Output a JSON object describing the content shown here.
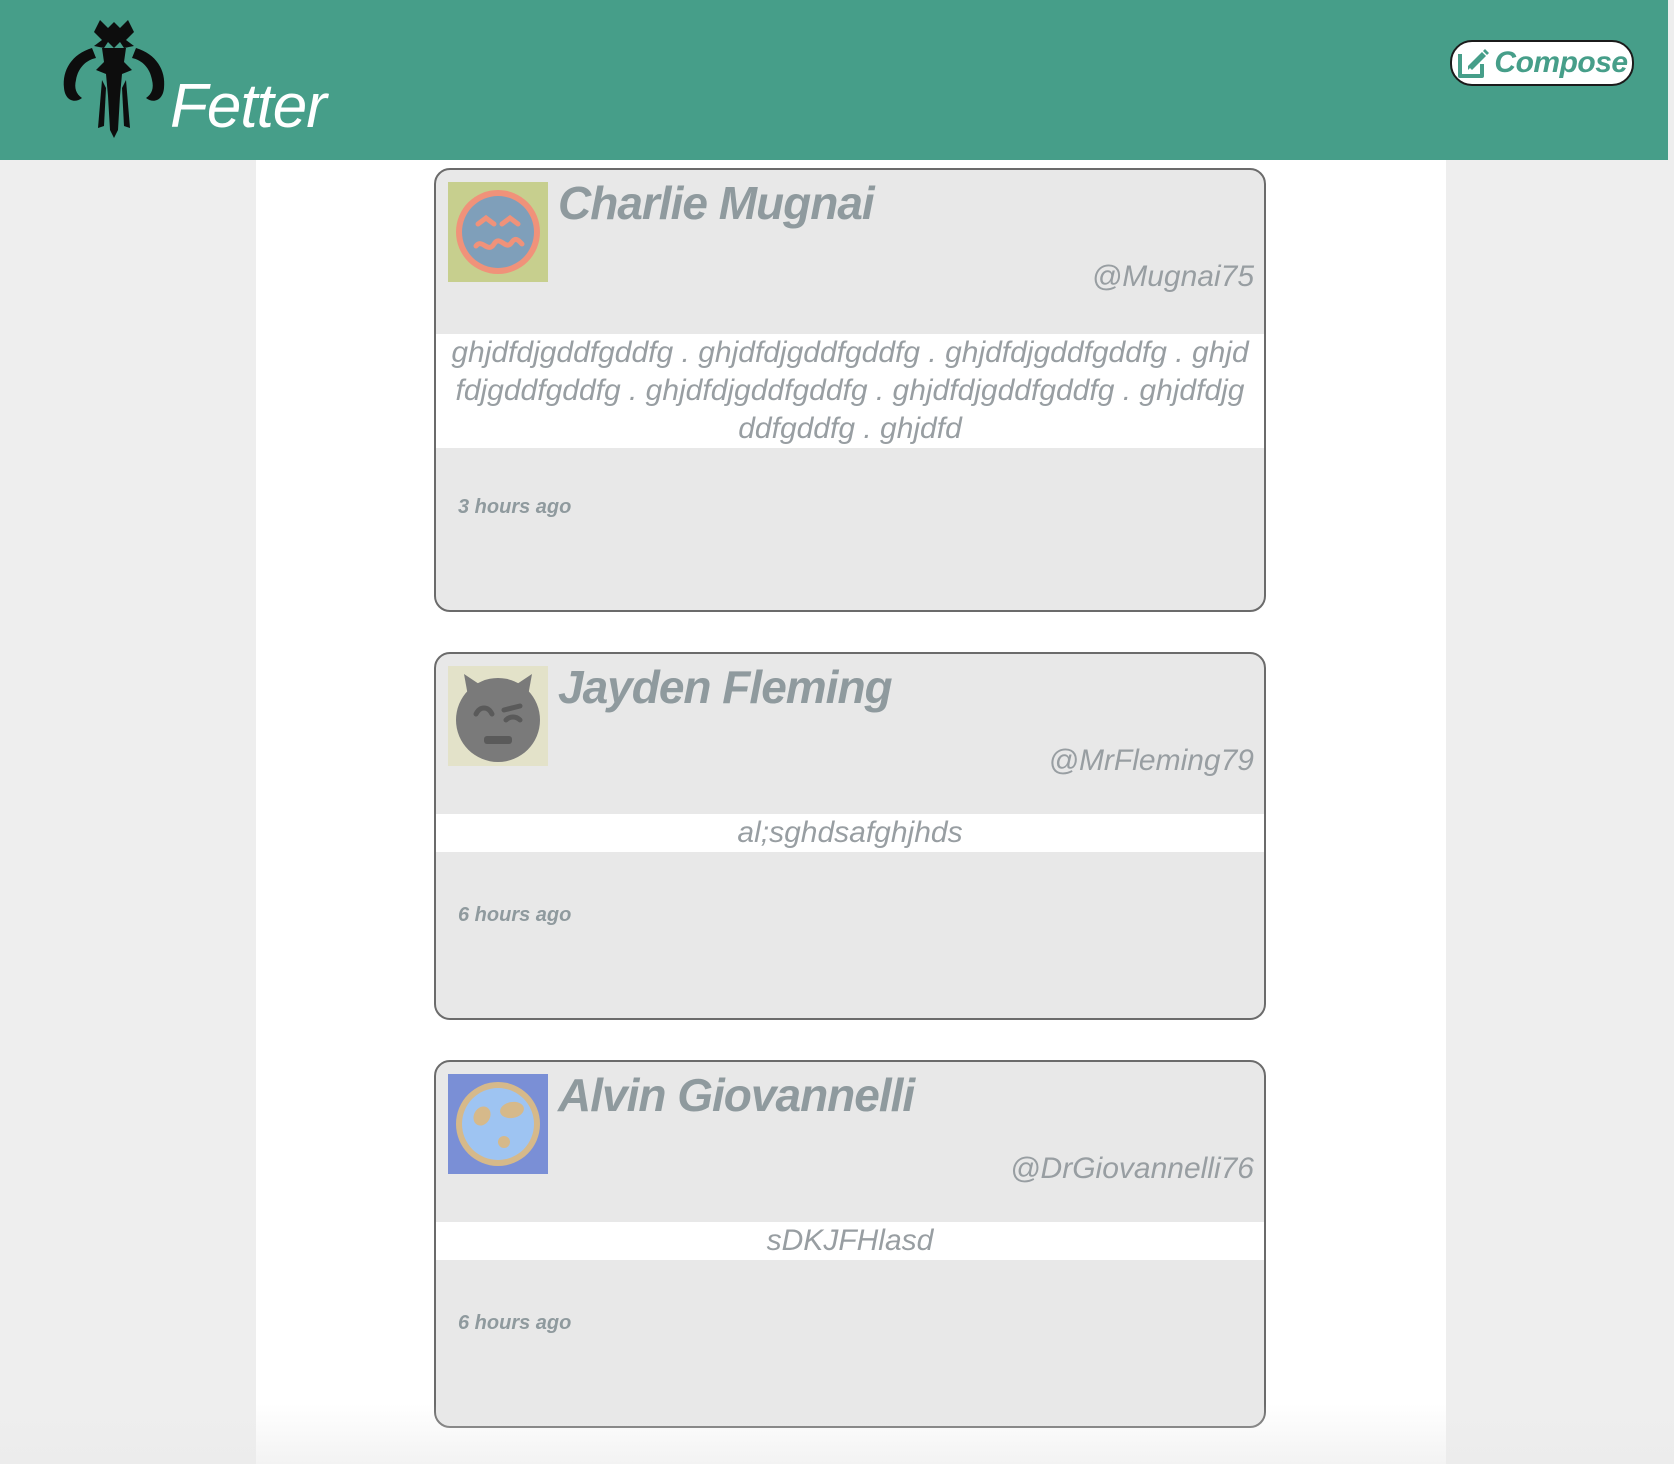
{
  "app": {
    "brand_name": "Fetter",
    "logo_icon": "mythosaur-skull-icon"
  },
  "header": {
    "compose_label": "Compose",
    "compose_icon": "edit-icon"
  },
  "colors": {
    "header_bg": "#469e89",
    "accent": "#469e89",
    "card_bg": "#e8e8e8",
    "muted_text": "#8f9a9e"
  },
  "posts": [
    {
      "name": "Charlie Mugnai",
      "handle": "@Mugnai75",
      "body": "ghjdfdjgddfgddfg . ghjdfdjgddfgddfg . ghjdfdjgddfgddfg . ghjdfdjgddfgddfg . ghjdfdjgddfgddfg . ghjdfdjgddfgddfg . ghjdfdjgddfgddfg . ghjdfd",
      "time": "3 hours ago",
      "avatar_icon": "squinting-face-avatar-icon"
    },
    {
      "name": "Jayden Fleming",
      "handle": "@MrFleming79",
      "body": "al;sghdsafghjhds",
      "time": "6 hours ago",
      "avatar_icon": "devil-face-avatar-icon"
    },
    {
      "name": "Alvin Giovannelli",
      "handle": "@DrGiovannelli76",
      "body": "sDKJFHlasd",
      "time": "6 hours ago",
      "avatar_icon": "surprised-face-avatar-icon"
    }
  ]
}
